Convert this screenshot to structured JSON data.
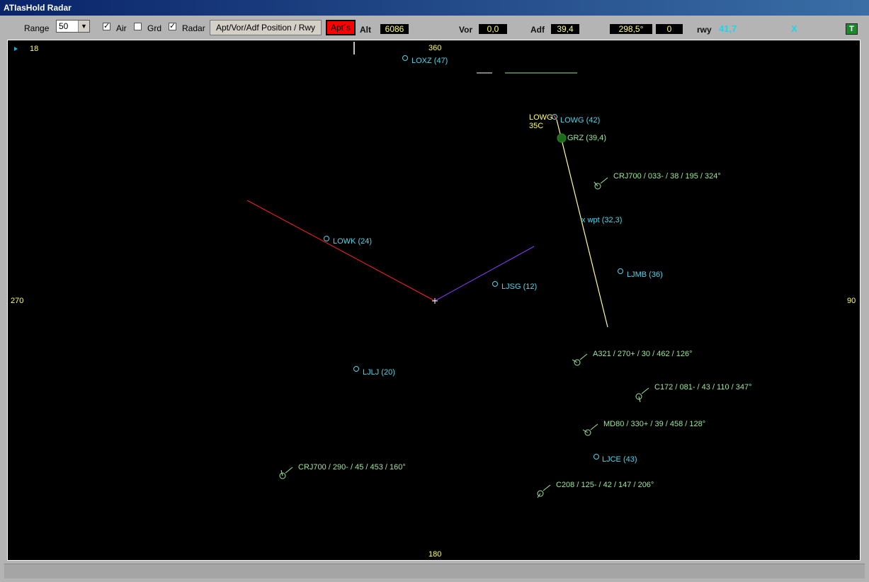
{
  "window": {
    "title": "ATIasHold Radar"
  },
  "toolbar": {
    "range_label": "Range",
    "range_value": "50",
    "air_label": "Air",
    "air_checked": "✓",
    "grd_label": "Grd",
    "radar_label": "Radar",
    "radar_checked": "✓",
    "apt_position_button": "Apt/Vor/Adf Position / Rwy",
    "apts_button": "Apt´s",
    "alt_label": "Alt",
    "alt_value": "6086",
    "vor_label": "Vor",
    "vor_value": "0,0",
    "adf_label": "Adf",
    "adf_value": "39,4",
    "heading_value": "298,5°",
    "zero_value": "0",
    "rwy_label": "rwy",
    "rwy_value": "41,7",
    "x_label": "X",
    "t_label": "T"
  },
  "radar": {
    "corner_value": "18",
    "compass": {
      "n": "360",
      "e": "90",
      "s": "180",
      "w": "270"
    },
    "airports": [
      {
        "label": "LOXZ (47)"
      },
      {
        "label": "LOWG (42)"
      },
      {
        "label": "LOWK (24)"
      },
      {
        "label": "LJSG (12)"
      },
      {
        "label": "LJMB (36)"
      },
      {
        "label": "LJLJ (20)"
      },
      {
        "label": "LJCE (43)"
      }
    ],
    "runway_label_1": "LOWG",
    "runway_label_2": "35C",
    "adf_station": "GRZ (39,4)",
    "waypoint": "x wpt (32,3)",
    "traffic": [
      {
        "label": "CRJ700 / 033- / 38 / 195 / 324°"
      },
      {
        "label": "A321 / 270+ / 30 / 462 / 126°"
      },
      {
        "label": "C172 / 081- / 43 / 110 / 347°"
      },
      {
        "label": "MD80 / 330+ / 39 / 458 / 128°"
      },
      {
        "label": "CRJ700 / 290- / 45 / 453 / 160°"
      },
      {
        "label": "C208 / 125- / 42 / 147 / 206°"
      }
    ],
    "colors": {
      "airport": "#4fd6e8",
      "traffic": "#9be89b",
      "compass": "#ffff66",
      "heading_line": "#ff2020",
      "course_line": "#8a3cff",
      "approach_line": "#ffff99"
    }
  }
}
